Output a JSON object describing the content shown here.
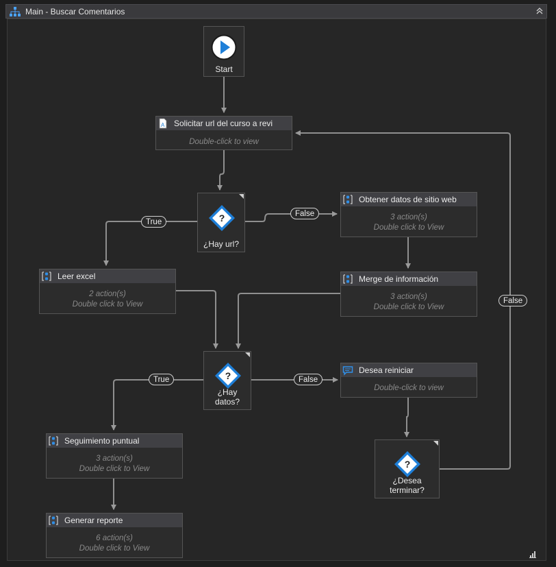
{
  "window": {
    "title": "Main - Buscar Comentarios"
  },
  "start": {
    "label": "Start"
  },
  "activities": {
    "solicitar": {
      "title": "Solicitar url del curso a revi",
      "hint": "Double-click to view"
    },
    "obtener": {
      "title": "Obtener datos de sitio web",
      "count": "3 action(s)",
      "hint": "Double click to View"
    },
    "leer": {
      "title": "Leer excel",
      "count": "2 action(s)",
      "hint": "Double click to View"
    },
    "merge": {
      "title": "Merge de información",
      "count": "3 action(s)",
      "hint": "Double click to View"
    },
    "reiniciar": {
      "title": "Desea reiniciar",
      "hint": "Double-click to view"
    },
    "seguimiento": {
      "title": "Seguimiento puntual",
      "count": "3 action(s)",
      "hint": "Double click to View"
    },
    "reporte": {
      "title": "Generar reporte",
      "count": "6 action(s)",
      "hint": "Double click to View"
    }
  },
  "decisions": {
    "hay_url": {
      "label": "¿Hay url?"
    },
    "hay_datos": {
      "label": "¿Hay datos?"
    },
    "terminar": {
      "label": "¿Desea terminar?"
    }
  },
  "branches": {
    "url_true": "True",
    "url_false": "False",
    "datos_true": "True",
    "datos_false": "False",
    "terminar_false": "False"
  },
  "colors": {
    "accent": "#1e7fd8",
    "wire": "#9a9a9a"
  }
}
